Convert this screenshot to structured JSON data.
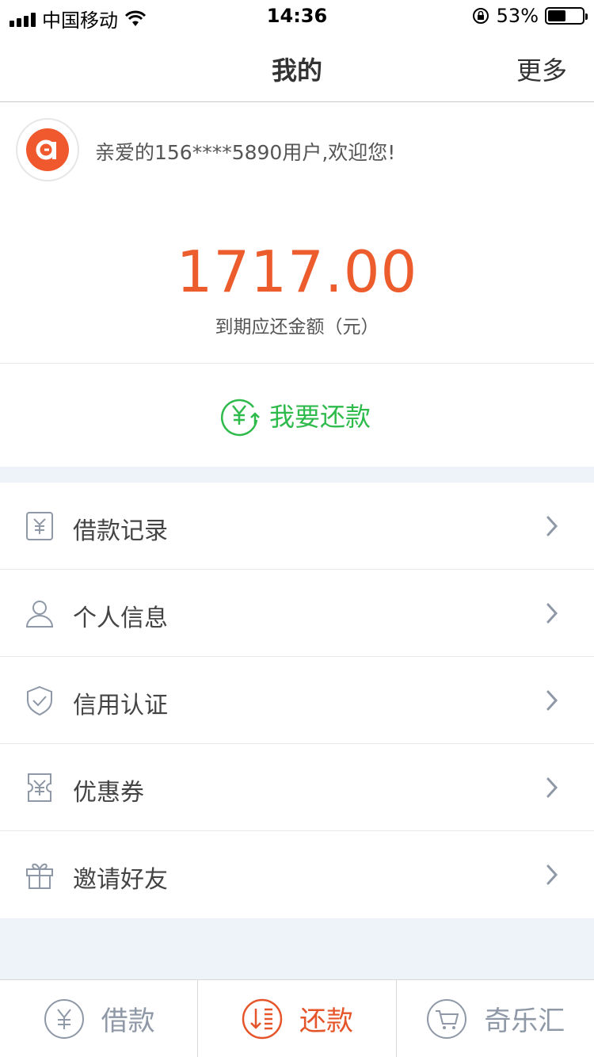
{
  "status_bar": {
    "carrier": "中国移动",
    "time": "14:36",
    "battery": "53%",
    "battery_level": 0.53
  },
  "nav": {
    "title": "我的",
    "more": "更多"
  },
  "profile": {
    "welcome": "亲爱的156****5890用户,欢迎您!"
  },
  "summary": {
    "amount": "1717.00",
    "amount_label": "到期应还金额（元）",
    "repay_button": "我要还款"
  },
  "menu": [
    {
      "label": "借款记录",
      "icon": "loan-record-icon"
    },
    {
      "label": "个人信息",
      "icon": "person-icon"
    },
    {
      "label": "信用认证",
      "icon": "shield-check-icon"
    },
    {
      "label": "优惠券",
      "icon": "coupon-icon"
    },
    {
      "label": "邀请好友",
      "icon": "gift-icon"
    }
  ],
  "tabs": [
    {
      "label": "借款",
      "icon": "yen-circle-icon",
      "active": false
    },
    {
      "label": "还款",
      "icon": "repay-circle-icon",
      "active": true
    },
    {
      "label": "奇乐汇",
      "icon": "cart-circle-icon",
      "active": false
    }
  ],
  "colors": {
    "accent_orange": "#ec5c2d",
    "accent_green": "#2ebb4b",
    "icon_gray": "#8e98a6",
    "page_bg": "#eef2f9"
  }
}
